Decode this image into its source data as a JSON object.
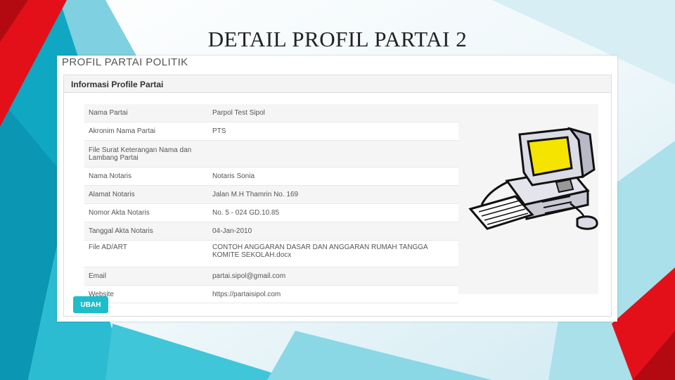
{
  "slide": {
    "title": "DETAIL PROFIL PARTAI 2"
  },
  "page": {
    "heading": "PROFIL PARTAI POLITIK"
  },
  "panel": {
    "title": "Informasi Profile Partai",
    "rows": [
      {
        "label": "Nama Partai",
        "value": "Parpol Test Sipol"
      },
      {
        "label": "Akronim Nama Partai",
        "value": "PTS"
      },
      {
        "label": "File Surat Keterangan Nama dan Lambang Partai",
        "value": ""
      },
      {
        "label": "Nama Notaris",
        "value": "Notaris Sonia"
      },
      {
        "label": "Alamat Notaris",
        "value": "Jalan M.H Thamrin No. 169"
      },
      {
        "label": "Nomor Akta Notaris",
        "value": "No. 5 - 024 GD.10.85"
      },
      {
        "label": "Tanggal Akta Notaris",
        "value": "04-Jan-2010"
      },
      {
        "label": "File AD/ART",
        "value": "CONTOH ANGGARAN DASAR DAN ANGGARAN RUMAH TANGGA KOMITE SEKOLAH.docx"
      },
      {
        "label": "Email",
        "value": "partai.sipol@gmail.com"
      },
      {
        "label": "Website",
        "value": "https://partaisipol.com"
      }
    ],
    "logo_icon": "computer-icon",
    "button_label": "UBAH"
  },
  "colors": {
    "accent_red": "#e3101a",
    "accent_teal": "#12b0c8",
    "button": "#1fbdc9"
  }
}
